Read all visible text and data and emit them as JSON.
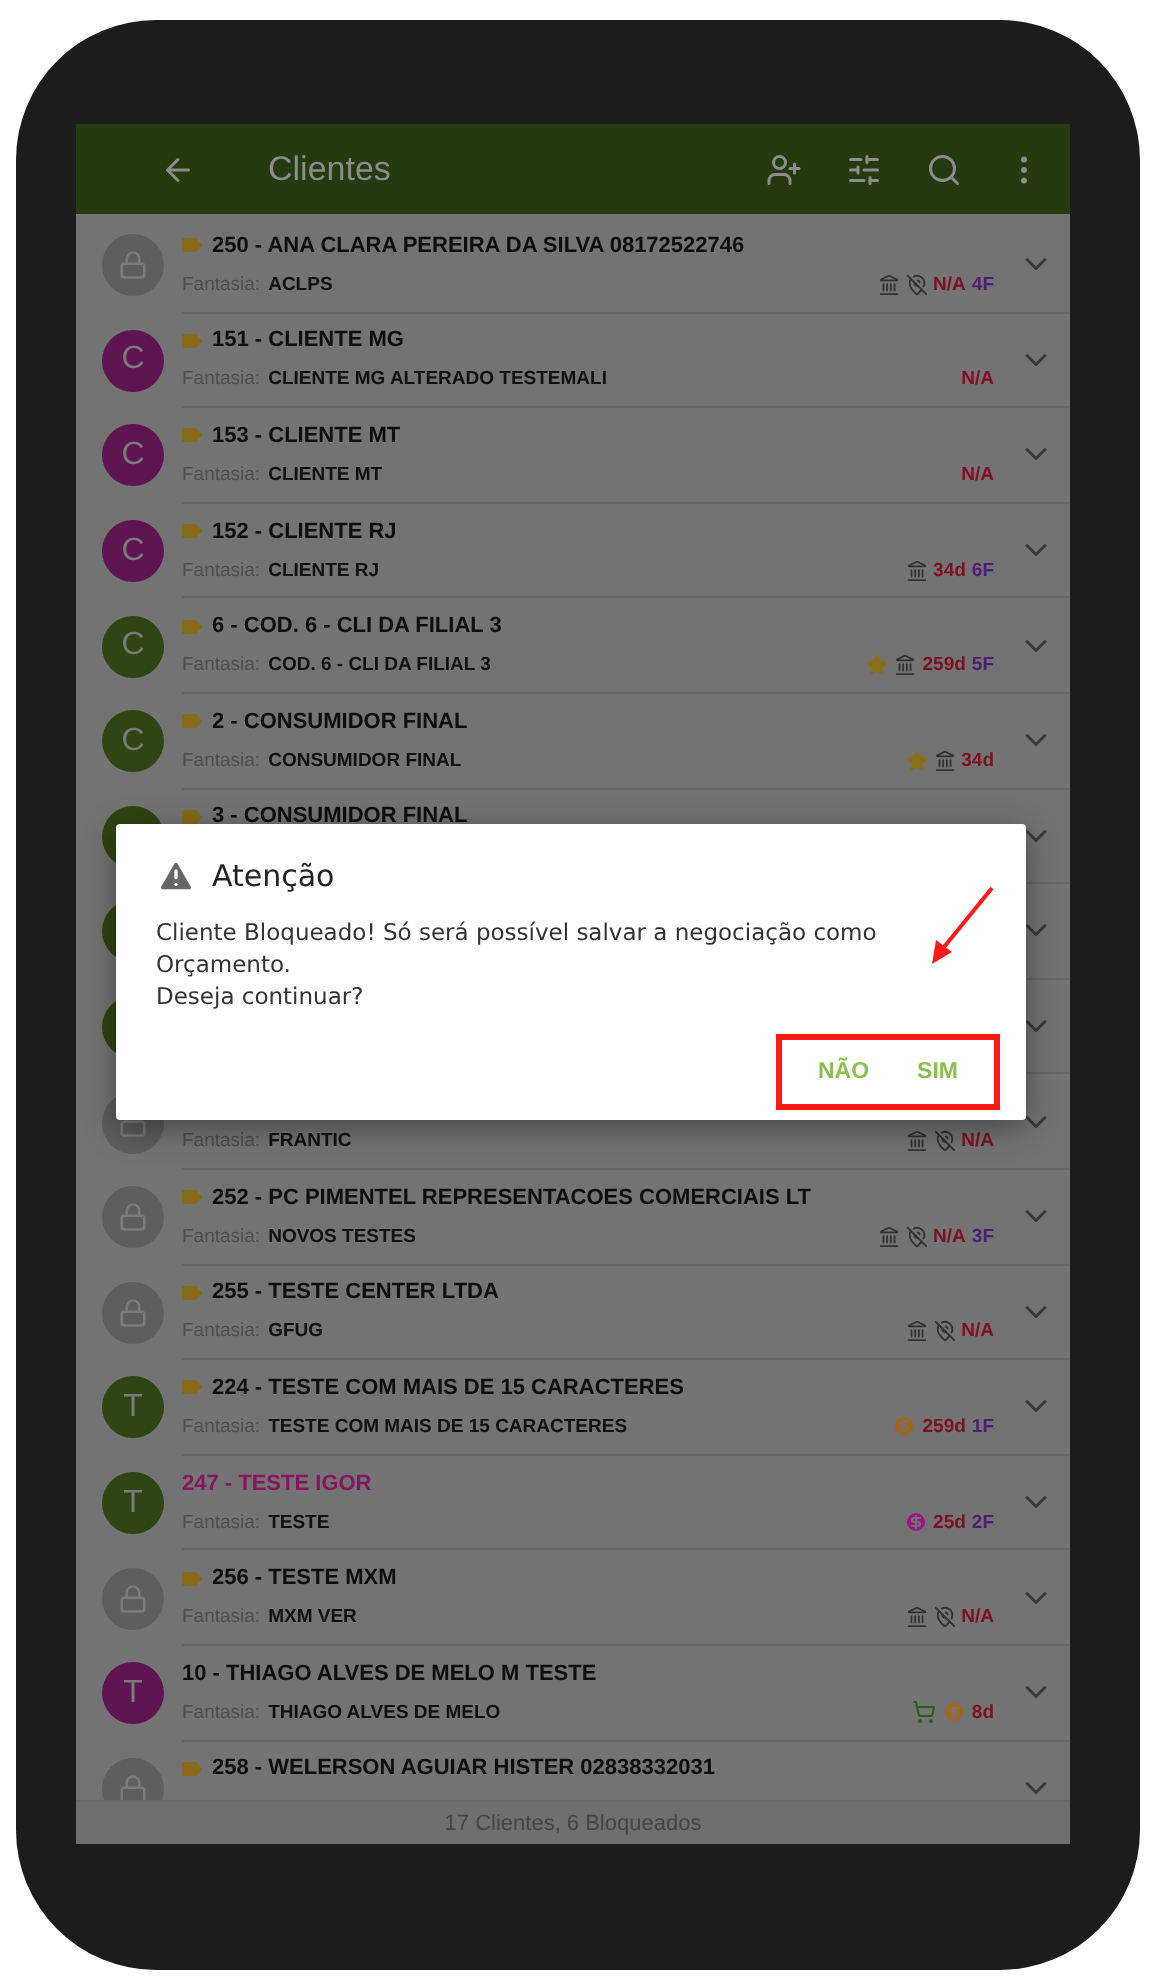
{
  "app_bar": {
    "title": "Clientes"
  },
  "clients": [
    {
      "avatar": {
        "kind": "locked"
      },
      "tagged": true,
      "highlighted": false,
      "title": "250 - ANA CLARA PEREIRA DA SILVA 08172522746",
      "fantasia_label": "Fantasia:",
      "fantasia": "ACLPS",
      "badges": [
        {
          "kind": "bank"
        },
        {
          "kind": "pin-off"
        }
      ],
      "status": "N/A",
      "count": "4F"
    },
    {
      "avatar": {
        "kind": "letter",
        "letter": "C",
        "color": "#5e1552"
      },
      "tagged": true,
      "highlighted": false,
      "title": "151 - CLIENTE MG",
      "fantasia_label": "Fantasia:",
      "fantasia": "CLIENTE MG ALTERADO TESTEMALI",
      "status": "N/A"
    },
    {
      "avatar": {
        "kind": "letter",
        "letter": "C",
        "color": "#5e1552"
      },
      "tagged": true,
      "highlighted": false,
      "title": "153 - CLIENTE MT",
      "fantasia_label": "Fantasia:",
      "fantasia": "CLIENTE MT",
      "status": "N/A"
    },
    {
      "avatar": {
        "kind": "letter",
        "letter": "C",
        "color": "#5e1552"
      },
      "tagged": true,
      "highlighted": false,
      "title": "152 - CLIENTE RJ",
      "fantasia_label": "Fantasia:",
      "fantasia": "CLIENTE RJ",
      "badges": [
        {
          "kind": "bank"
        }
      ],
      "status": "34d",
      "count": "6F"
    },
    {
      "avatar": {
        "kind": "letter",
        "letter": "C",
        "color": "#2f4513"
      },
      "tagged": true,
      "highlighted": false,
      "title": "6 - COD. 6 - CLI DA FILIAL 3",
      "fantasia_label": "Fantasia:",
      "fantasia": "COD. 6 - CLI DA FILIAL 3",
      "badges": [
        {
          "kind": "star"
        },
        {
          "kind": "bank"
        }
      ],
      "status": "259d",
      "count": "5F"
    },
    {
      "avatar": {
        "kind": "letter",
        "letter": "C",
        "color": "#2f4513"
      },
      "tagged": true,
      "highlighted": false,
      "title": "2 - CONSUMIDOR FINAL",
      "fantasia_label": "Fantasia:",
      "fantasia": "CONSUMIDOR FINAL",
      "badges": [
        {
          "kind": "star"
        },
        {
          "kind": "bank"
        }
      ],
      "status": "34d"
    },
    {
      "avatar": {
        "kind": "letter",
        "color": "#2f4513"
      },
      "tagged": true,
      "highlighted": false,
      "title": "3 - CONSUMIDOR FINAL"
    },
    {
      "avatar": {
        "kind": "letter",
        "color": "#2f4513"
      }
    },
    {
      "avatar": {
        "kind": "letter",
        "color": "#2f4513"
      }
    },
    {
      "avatar": {
        "kind": "locked"
      },
      "fantasia_label": "Fantasia:",
      "fantasia": "FRANTIC",
      "badges": [
        {
          "kind": "bank"
        },
        {
          "kind": "pin-off"
        }
      ],
      "status": "N/A"
    },
    {
      "avatar": {
        "kind": "locked"
      },
      "tagged": true,
      "highlighted": false,
      "title": "252 - PC PIMENTEL REPRESENTACOES COMERCIAIS LT",
      "fantasia_label": "Fantasia:",
      "fantasia": "NOVOS TESTES",
      "badges": [
        {
          "kind": "bank"
        },
        {
          "kind": "pin-off"
        }
      ],
      "status": "N/A",
      "count": "3F"
    },
    {
      "avatar": {
        "kind": "locked"
      },
      "tagged": true,
      "highlighted": false,
      "title": "255 - TESTE CENTER LTDA",
      "fantasia_label": "Fantasia:",
      "fantasia": "GFUG",
      "badges": [
        {
          "kind": "bank"
        },
        {
          "kind": "pin-off"
        }
      ],
      "status": "N/A"
    },
    {
      "avatar": {
        "kind": "letter",
        "letter": "T",
        "color": "#2f4513"
      },
      "tagged": true,
      "highlighted": false,
      "title": "224 - TESTE COM MAIS DE 15 CARACTERES",
      "fantasia_label": "Fantasia:",
      "fantasia": "TESTE COM MAIS DE 15 CARACTERES",
      "badges": [
        {
          "kind": "coin",
          "color": "#a8660f"
        }
      ],
      "status": "259d",
      "count": "1F"
    },
    {
      "avatar": {
        "kind": "letter",
        "letter": "T",
        "color": "#2f4513"
      },
      "tagged": false,
      "highlighted": true,
      "title": "247 - TESTE IGOR",
      "fantasia_label": "Fantasia:",
      "fantasia": "TESTE",
      "badges": [
        {
          "kind": "coin",
          "color": "#9c1580"
        }
      ],
      "status": "25d",
      "count": "2F"
    },
    {
      "avatar": {
        "kind": "locked"
      },
      "tagged": true,
      "highlighted": false,
      "title": "256 - TESTE MXM",
      "fantasia_label": "Fantasia:",
      "fantasia": "MXM VER",
      "badges": [
        {
          "kind": "bank"
        },
        {
          "kind": "pin-off"
        }
      ],
      "status": "N/A"
    },
    {
      "avatar": {
        "kind": "letter",
        "letter": "T",
        "color": "#5e1552"
      },
      "tagged": false,
      "highlighted": false,
      "title": "10 - THIAGO ALVES DE MELO M TESTE",
      "fantasia_label": "Fantasia:",
      "fantasia": "THIAGO ALVES DE MELO",
      "badges": [
        {
          "kind": "cart"
        },
        {
          "kind": "coin",
          "color": "#a8660f"
        }
      ],
      "status": "8d"
    },
    {
      "avatar": {
        "kind": "locked"
      },
      "tagged": true,
      "highlighted": false,
      "title": "258 - WELERSON AGUIAR HISTER 02838332031"
    }
  ],
  "footer": "17 Clientes, 6 Bloqueados",
  "dialog": {
    "title": "Atenção",
    "message": [
      "Cliente Bloqueado! Só será possível salvar a negociação como Orçamento.",
      "Deseja continuar?"
    ],
    "buttons": [
      "NÃO",
      "SIM"
    ]
  }
}
